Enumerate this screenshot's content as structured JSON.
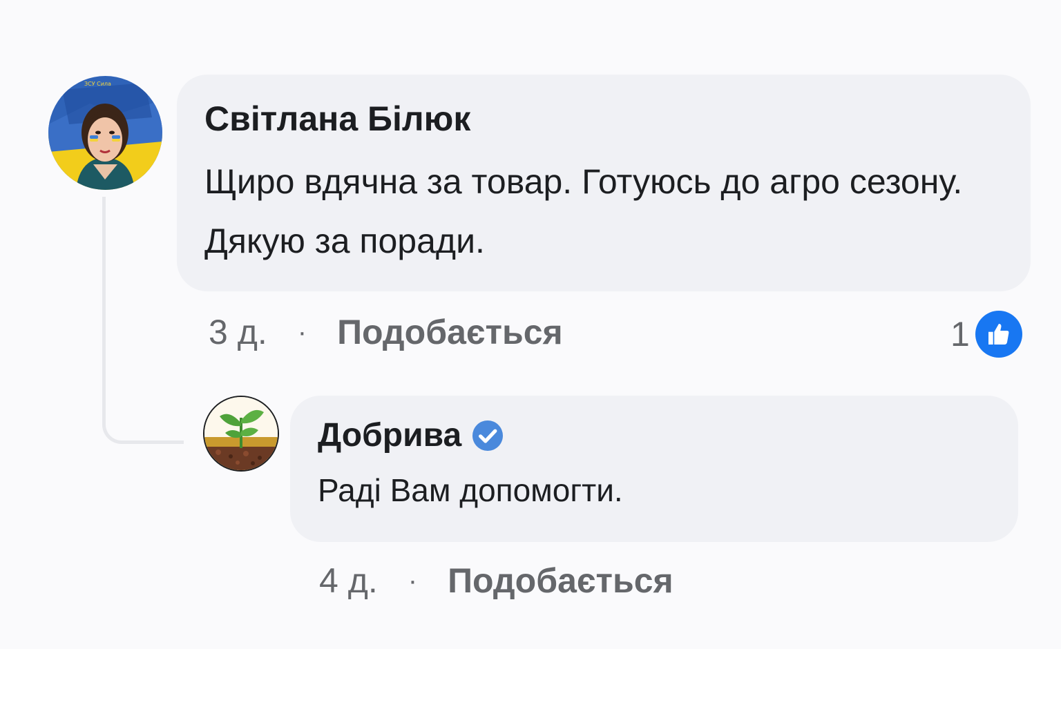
{
  "comments": [
    {
      "author": "Світлана Білюк",
      "text": "Щиро вдячна за товар. Готуюсь до агро сезону. Дякую за поради.",
      "time": "3 д.",
      "like_label": "Подобається",
      "reaction_count": "1",
      "reaction_icon": "thumbs-up-icon",
      "avatar_banner_text": "ЗСУ Сила"
    },
    {
      "author": "Добрива",
      "verified": true,
      "text": "Раді Вам допомогти.",
      "time": "4 д.",
      "like_label": "Подобається",
      "avatar_icon": "sprout-in-soil-icon"
    }
  ],
  "separator": "·",
  "colors": {
    "bubble": "#f0f1f5",
    "text": "#1c1e21",
    "meta": "#65676b",
    "like_blue": "#1877f2",
    "verified_blue": "#4a89dc"
  }
}
